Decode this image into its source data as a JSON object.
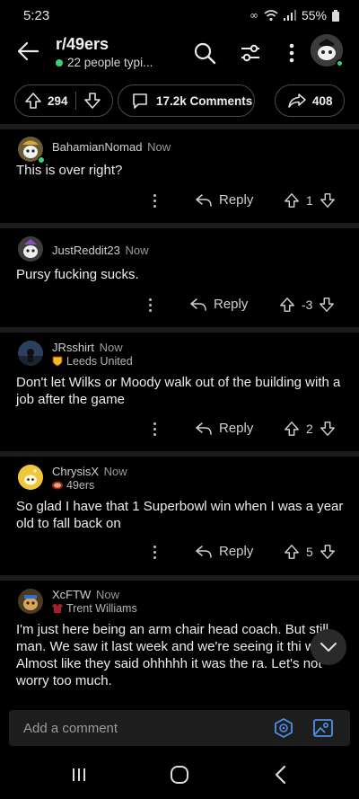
{
  "status_bar": {
    "time": "5:23",
    "battery": "55%"
  },
  "header": {
    "subreddit": "r/49ers",
    "typing_status": "22 people typi..."
  },
  "actions": {
    "upvotes": "294",
    "comments": "17.2k Comments",
    "shares": "408"
  },
  "comments": [
    {
      "user": "BahamianNomad",
      "time": "Now",
      "flair": "",
      "body": "This is over right?",
      "reply_label": "Reply",
      "score": "1"
    },
    {
      "user": "JustReddit23",
      "time": "Now",
      "flair": "",
      "body": "Pursy fucking sucks.",
      "reply_label": "Reply",
      "score": "-3"
    },
    {
      "user": "JRsshirt",
      "time": "Now",
      "flair": "Leeds United",
      "body": "Don't let Wilks or Moody walk out of the building with a job after the game",
      "reply_label": "Reply",
      "score": "2"
    },
    {
      "user": "ChrysisX",
      "time": "Now",
      "flair": "49ers",
      "body": "So glad I have that 1 Superbowl win when I was a year old to fall back on",
      "reply_label": "Reply",
      "score": "5"
    },
    {
      "user": "XcFTW",
      "time": "Now",
      "flair": "Trent Williams",
      "body": "I'm just here being an arm chair head coach. But still man. We saw it last week and we're seeing it thi week. Almost like they said ohhhhh it was the ra. Let's not worry too much.",
      "reply_label": "",
      "score": ""
    }
  ],
  "composer": {
    "placeholder": "Add a comment"
  },
  "colors": {
    "accent_blue": "#4f8fe8",
    "online_green": "#3ad17a",
    "background": "#000000"
  }
}
